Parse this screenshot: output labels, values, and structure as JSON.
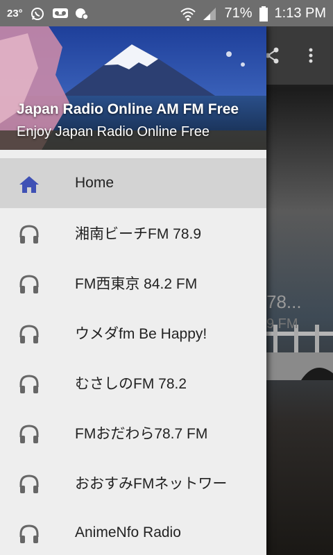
{
  "status_bar": {
    "temperature": "23°",
    "battery": "71%",
    "time": "1:13 PM"
  },
  "drawer": {
    "title": "Japan Radio Online AM FM Free",
    "subtitle": "Enjoy Japan Radio Online Free",
    "items": [
      {
        "label": "Home",
        "icon": "home-icon",
        "active": true
      },
      {
        "label": "湘南ビーチFM 78.9",
        "icon": "headphones-icon"
      },
      {
        "label": "FM西東京 84.2 FM",
        "icon": "headphones-icon"
      },
      {
        "label": "ウメダfm Be Happy!",
        "icon": "headphones-icon"
      },
      {
        "label": "むさしのFM 78.2",
        "icon": "headphones-icon"
      },
      {
        "label": "FMおだわら78.7 FM",
        "icon": "headphones-icon"
      },
      {
        "label": "おおすみFMネットワー",
        "icon": "headphones-icon"
      },
      {
        "label": "AnimeNfo Radio",
        "icon": "headphones-icon"
      }
    ]
  },
  "background": {
    "text1": "78...",
    "text2": "9 FM"
  },
  "colors": {
    "accent": "#3f51b5",
    "active_bg": "#d3d3d3",
    "drawer_bg": "#eeeeee",
    "icon_gray": "#666666"
  }
}
